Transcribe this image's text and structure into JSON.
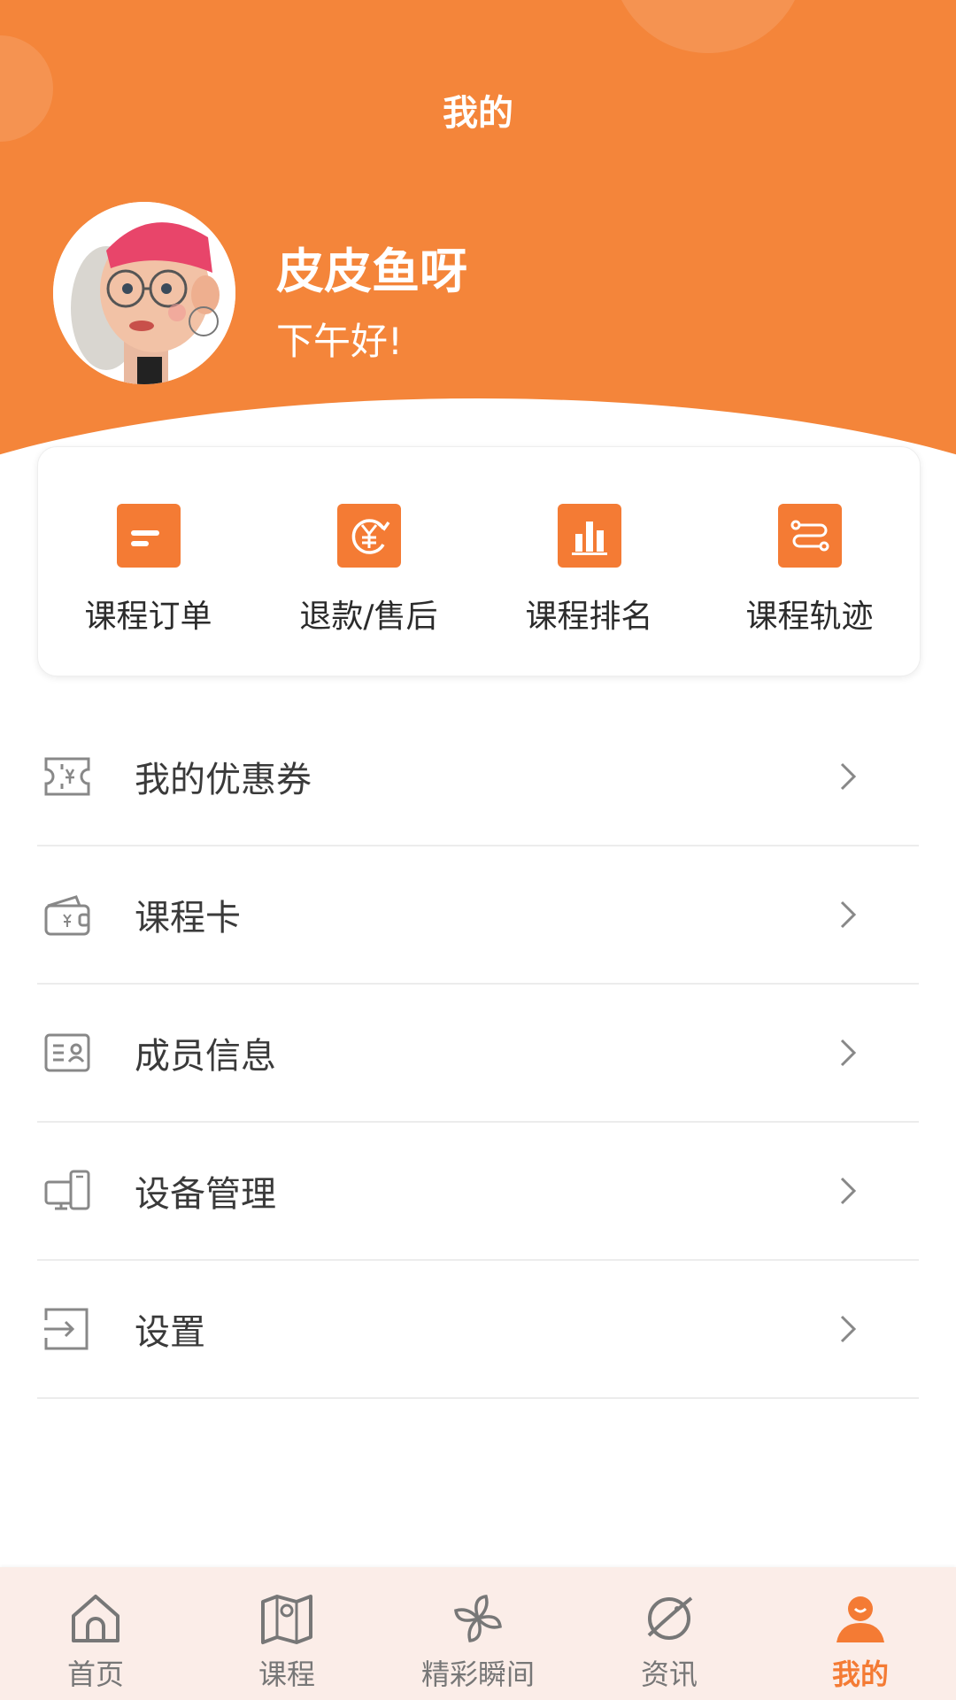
{
  "header": {
    "title": "我的",
    "username": "皮皮鱼呀",
    "greeting": "下午好!"
  },
  "colors": {
    "accent": "#F4853A",
    "icon_fill": "#F47B34",
    "tabbar_bg": "#FBEDE8"
  },
  "quick_actions": [
    {
      "label": "课程订单",
      "icon": "clipboard-icon"
    },
    {
      "label": "退款/售后",
      "icon": "refund-yen-icon"
    },
    {
      "label": "课程排名",
      "icon": "bar-chart-icon"
    },
    {
      "label": "课程轨迹",
      "icon": "route-icon"
    }
  ],
  "menu": [
    {
      "label": "我的优惠券",
      "icon": "coupon-icon"
    },
    {
      "label": "课程卡",
      "icon": "wallet-card-icon"
    },
    {
      "label": "成员信息",
      "icon": "member-card-icon"
    },
    {
      "label": "设备管理",
      "icon": "device-icon"
    },
    {
      "label": "设置",
      "icon": "exit-settings-icon"
    }
  ],
  "tabs": [
    {
      "label": "首页",
      "icon": "home-icon",
      "active": false
    },
    {
      "label": "课程",
      "icon": "map-icon",
      "active": false
    },
    {
      "label": "精彩瞬间",
      "icon": "pinwheel-icon",
      "active": false
    },
    {
      "label": "资讯",
      "icon": "planet-icon",
      "active": false
    },
    {
      "label": "我的",
      "icon": "profile-icon",
      "active": true
    }
  ]
}
